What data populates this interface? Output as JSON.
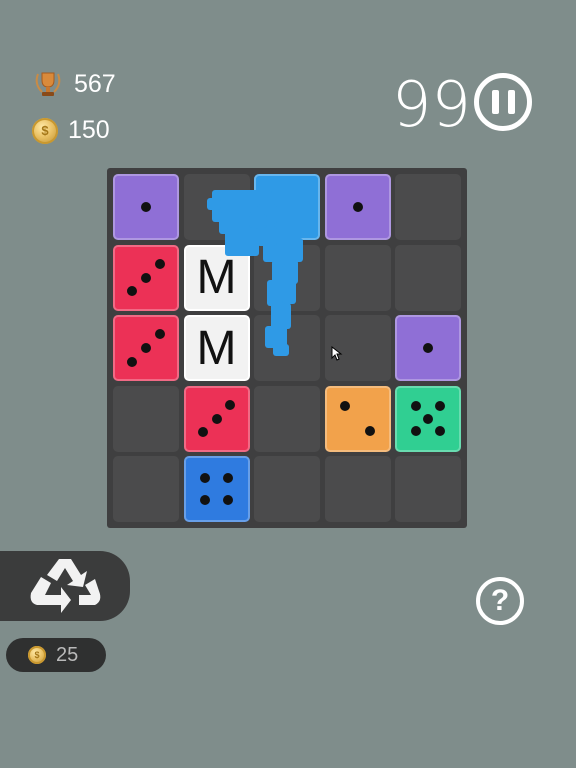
{
  "header": {
    "best_score": "567",
    "coins": "150",
    "coin_symbol": "$",
    "score": "99"
  },
  "colors": {
    "purple": "#8f6fd6",
    "red": "#ec3156",
    "orange": "#f2a24b",
    "green": "#30cf92",
    "blue": "#2f7be0",
    "light_blue": "#2f9ae6"
  },
  "board": {
    "rows": 5,
    "cols": 5,
    "dice": [
      {
        "row": 0,
        "col": 0,
        "color": "purple",
        "value": 1
      },
      {
        "row": 0,
        "col": 2,
        "color": "light_blue",
        "value": 0
      },
      {
        "row": 0,
        "col": 3,
        "color": "purple",
        "value": 1
      },
      {
        "row": 1,
        "col": 0,
        "color": "red",
        "value": 3
      },
      {
        "row": 2,
        "col": 0,
        "color": "red",
        "value": 3
      },
      {
        "row": 2,
        "col": 4,
        "color": "purple",
        "value": 1
      },
      {
        "row": 3,
        "col": 1,
        "color": "red",
        "value": 3
      },
      {
        "row": 3,
        "col": 3,
        "color": "orange",
        "value": 2
      },
      {
        "row": 3,
        "col": 4,
        "color": "green",
        "value": 5
      },
      {
        "row": 4,
        "col": 1,
        "color": "blue",
        "value": 4
      }
    ],
    "letter_tiles": [
      {
        "row": 1,
        "col": 1,
        "letter": "M"
      },
      {
        "row": 2,
        "col": 1,
        "letter": "M"
      }
    ]
  },
  "footer": {
    "recycle_cost": "25",
    "help_label": "?"
  }
}
